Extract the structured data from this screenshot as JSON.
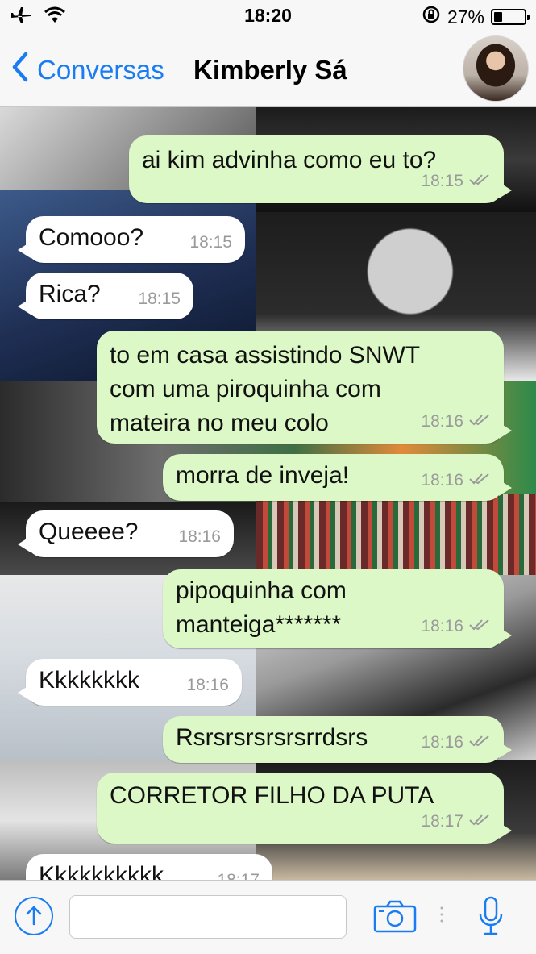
{
  "status_bar": {
    "time": "18:20",
    "battery_percent_label": "27%",
    "battery_level": 0.27,
    "icons": [
      "airplane-icon",
      "wifi-icon",
      "rotation-lock-icon",
      "battery-icon"
    ]
  },
  "header": {
    "back_label": "Conversas",
    "contact_name": "Kimberly Sá"
  },
  "messages": [
    {
      "dir": "out",
      "text": "ai kim advinha como eu to?",
      "time": "18:15",
      "read": true
    },
    {
      "dir": "in",
      "text": "Comooo?",
      "time": "18:15"
    },
    {
      "dir": "in",
      "text": "Rica?",
      "time": "18:15"
    },
    {
      "dir": "out",
      "text": "to em casa assistindo SNWT\ncom uma piroquinha com\nmateira no meu colo",
      "time": "18:16",
      "read": true
    },
    {
      "dir": "out",
      "text": "morra de inveja!",
      "time": "18:16",
      "read": true
    },
    {
      "dir": "in",
      "text": "Queeee?",
      "time": "18:16"
    },
    {
      "dir": "out",
      "text": "pipoquinha com\nmanteiga*******",
      "time": "18:16",
      "read": true
    },
    {
      "dir": "in",
      "text": "Kkkkkkkk",
      "time": "18:16"
    },
    {
      "dir": "out",
      "text": "Rsrsrsrsrsrsrrdsrs",
      "time": "18:16",
      "read": true
    },
    {
      "dir": "out",
      "text": "CORRETOR FILHO DA PUTA",
      "time": "18:17",
      "read": true
    },
    {
      "dir": "in",
      "text": "Kkkkkkkkkk",
      "time": "18:17"
    }
  ],
  "input_bar": {
    "placeholder": "",
    "icons": [
      "upload-icon",
      "camera-icon",
      "microphone-icon"
    ]
  },
  "colors": {
    "accent": "#1a7cf2",
    "outgoing_bubble": "#dcf8c6",
    "incoming_bubble": "#ffffff",
    "timestamp": "#9a9a9a"
  }
}
